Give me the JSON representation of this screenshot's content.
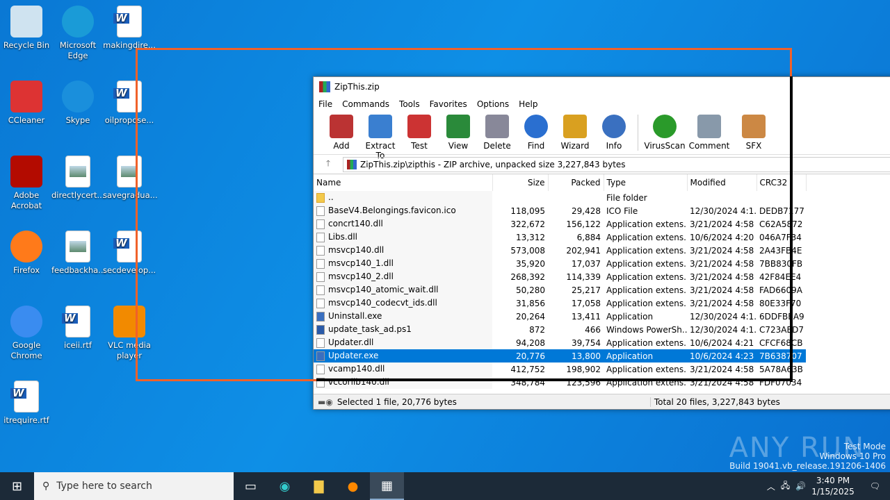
{
  "desktop": {
    "icons": [
      {
        "label": "Recycle Bin",
        "icon": "recycle-bin-icon"
      },
      {
        "label": "Microsoft Edge",
        "icon": "edge-icon"
      },
      {
        "label": "makingdire...",
        "icon": "word-doc-icon"
      },
      {
        "label": "CCleaner",
        "icon": "ccleaner-icon"
      },
      {
        "label": "Skype",
        "icon": "skype-icon"
      },
      {
        "label": "oilpropose...",
        "icon": "word-doc-icon"
      },
      {
        "label": "Adobe Acrobat",
        "icon": "acrobat-icon"
      },
      {
        "label": "directlycert...",
        "icon": "image-file-icon"
      },
      {
        "label": "savegradua...",
        "icon": "image-file-icon"
      },
      {
        "label": "Firefox",
        "icon": "firefox-icon"
      },
      {
        "label": "feedbackha...",
        "icon": "image-file-icon"
      },
      {
        "label": "secdevelop...",
        "icon": "word-doc-icon"
      },
      {
        "label": "Google Chrome",
        "icon": "chrome-icon"
      },
      {
        "label": "iceii.rtf",
        "icon": "word-doc-icon"
      },
      {
        "label": "VLC media player",
        "icon": "vlc-icon"
      },
      {
        "label": "itrequire.rtf",
        "icon": "word-doc-icon"
      }
    ]
  },
  "window": {
    "title": "ZipThis.zip",
    "menu": [
      "File",
      "Commands",
      "Tools",
      "Favorites",
      "Options",
      "Help"
    ],
    "toolbar": [
      "Add",
      "Extract To",
      "Test",
      "View",
      "Delete",
      "Find",
      "Wizard",
      "Info",
      "VirusScan",
      "Comment",
      "SFX"
    ],
    "address": "ZipThis.zip\\zipthis - ZIP archive, unpacked size 3,227,843 bytes",
    "columns": [
      "Name",
      "Size",
      "Packed",
      "Type",
      "Modified",
      "CRC32"
    ],
    "rows": [
      [
        "..",
        "",
        "",
        "File folder",
        "",
        ""
      ],
      [
        "BaseV4.Belongings.favicon.ico",
        "118,095",
        "29,428",
        "ICO File",
        "12/30/2024 4:1...",
        "DEDB7177"
      ],
      [
        "concrt140.dll",
        "322,672",
        "156,122",
        "Application extens...",
        "3/21/2024 4:58 ...",
        "C62A5872"
      ],
      [
        "Libs.dll",
        "13,312",
        "6,884",
        "Application extens...",
        "10/6/2024 4:20 ...",
        "046A7F34"
      ],
      [
        "msvcp140.dll",
        "573,008",
        "202,941",
        "Application extens...",
        "3/21/2024 4:58 ...",
        "2A43FB4E"
      ],
      [
        "msvcp140_1.dll",
        "35,920",
        "17,037",
        "Application extens...",
        "3/21/2024 4:58 ...",
        "7BB830FB"
      ],
      [
        "msvcp140_2.dll",
        "268,392",
        "114,339",
        "Application extens...",
        "3/21/2024 4:58 ...",
        "42F84EE4"
      ],
      [
        "msvcp140_atomic_wait.dll",
        "50,280",
        "25,217",
        "Application extens...",
        "3/21/2024 4:58 ...",
        "FAD6609A"
      ],
      [
        "msvcp140_codecvt_ids.dll",
        "31,856",
        "17,058",
        "Application extens...",
        "3/21/2024 4:58 ...",
        "80E33F70"
      ],
      [
        "Uninstall.exe",
        "20,264",
        "13,411",
        "Application",
        "12/30/2024 4:1...",
        "6DDFBEA9"
      ],
      [
        "update_task_ad.ps1",
        "872",
        "466",
        "Windows PowerSh...",
        "12/30/2024 4:1...",
        "C723AED7"
      ],
      [
        "Updater.dll",
        "94,208",
        "39,754",
        "Application extens...",
        "10/6/2024 4:21 ...",
        "CFCF68CB"
      ],
      [
        "Updater.exe",
        "20,776",
        "13,800",
        "Application",
        "10/6/2024 4:23 ...",
        "7B638707"
      ],
      [
        "vcamp140.dll",
        "412,752",
        "198,902",
        "Application extens...",
        "3/21/2024 4:58 ...",
        "5A78A63B"
      ],
      [
        "vccorlib140.dll",
        "348,784",
        "123,596",
        "Application extens...",
        "3/21/2024 4:58 ...",
        "FDF07034"
      ]
    ],
    "status_left": "Selected 1 file, 20,776 bytes",
    "status_right": "Total 20 files, 3,227,843 bytes"
  },
  "taskbar": {
    "search_placeholder": "Type here to search",
    "time": "3:40 PM",
    "date": "1/15/2025"
  },
  "watermark": {
    "brand": "ANY RUN",
    "line1": "Test Mode",
    "line2": "Windows 10 Pro",
    "line3": "Build 19041.vb_release.191206-1406"
  }
}
